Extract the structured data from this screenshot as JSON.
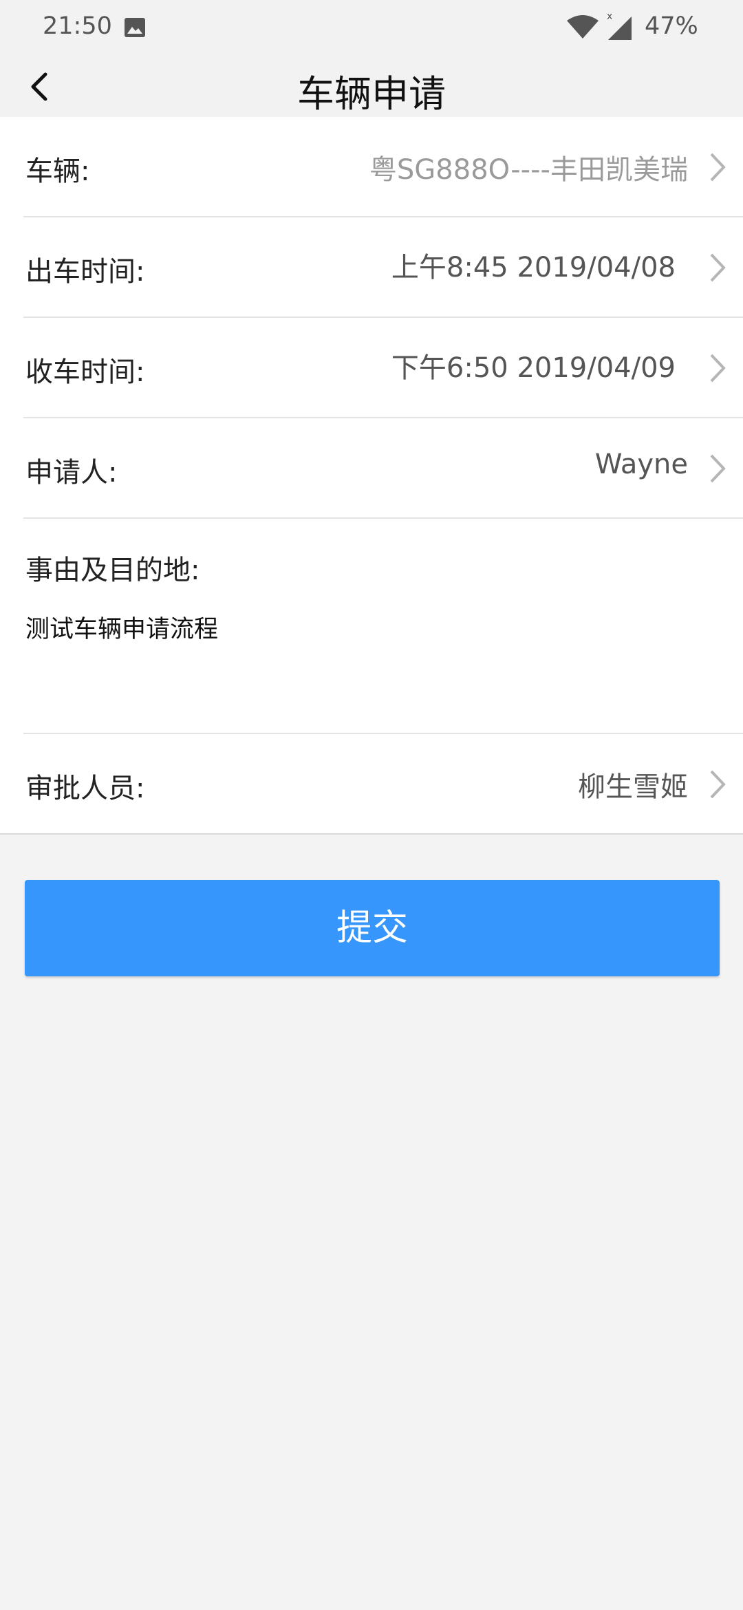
{
  "status_bar": {
    "time": "21:50",
    "battery": "47%",
    "icons": [
      "image-icon",
      "wifi-icon",
      "signal-icon"
    ]
  },
  "header": {
    "title": "车辆申请"
  },
  "form": {
    "vehicle": {
      "label": "车辆:",
      "value": "粤SG888O----丰田凯美瑞"
    },
    "depart_time": {
      "label": "出车时间:",
      "value": "上午8:45 2019/04/08"
    },
    "return_time": {
      "label": "收车时间:",
      "value": "下午6:50 2019/04/09"
    },
    "applicant": {
      "label": "申请人:",
      "value": "Wayne"
    },
    "reason": {
      "label": "事由及目的地:",
      "value": "测试车辆申请流程"
    },
    "approver": {
      "label": "审批人员:",
      "value": "柳生雪姬"
    }
  },
  "submit": {
    "label": "提交"
  },
  "colors": {
    "accent": "#3796fb",
    "background": "#f3f3f3"
  }
}
